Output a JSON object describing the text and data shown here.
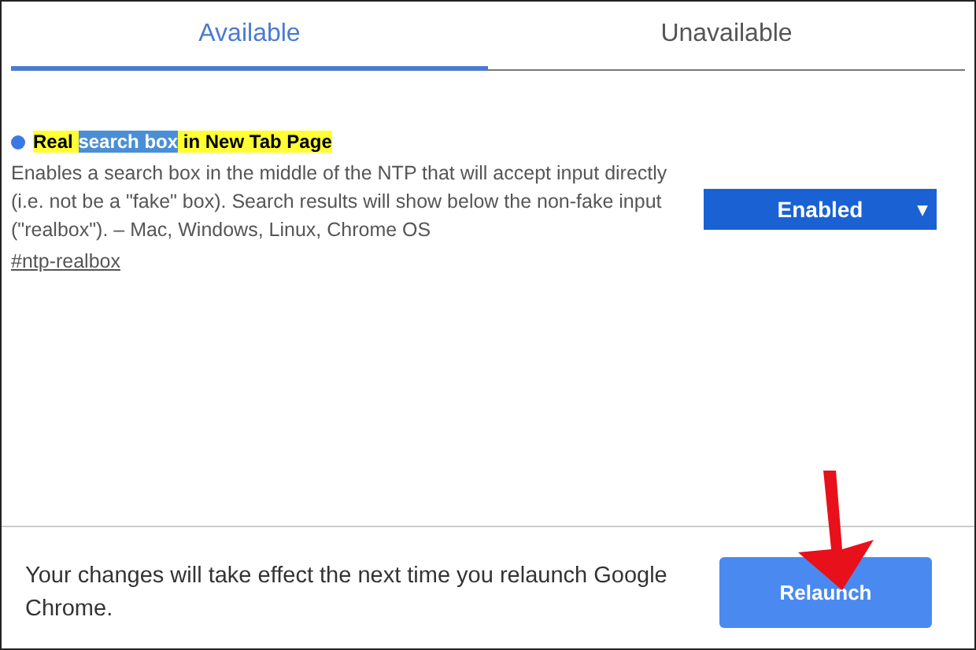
{
  "tabs": [
    {
      "label": "Available",
      "selected": true
    },
    {
      "label": "Unavailable",
      "selected": false
    }
  ],
  "flags": [
    {
      "title_parts": [
        {
          "text": "Real ",
          "kind": "highlight"
        },
        {
          "text": "search box",
          "kind": "match"
        },
        {
          "text": " in New Tab Page",
          "kind": "highlight"
        }
      ],
      "description": "Enables a search box in the middle of the NTP that will accept input directly (i.e. not be a \"fake\" box). Search results will show below the non-fake input (\"realbox\"). – Mac, Windows, Linux, Chrome OS",
      "link": "#ntp-realbox",
      "dropdown": {
        "value": "Enabled",
        "caret": "▾"
      }
    }
  ],
  "footer": {
    "message": "Your changes will take effect the next time you relaunch Google Chrome.",
    "button": "Relaunch"
  }
}
